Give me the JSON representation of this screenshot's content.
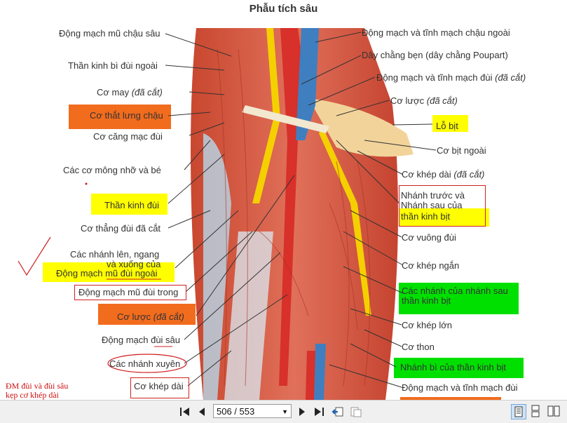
{
  "document": {
    "title": "Phẫu tích sâu",
    "labels_left": [
      "Động mạch mũ chậu sâu",
      "Thần kinh bì đùi ngoài",
      "Cơ may",
      "Cơ thắt lưng chậu",
      "Cơ căng mạc đùi",
      "Các cơ mông nhỡ và bé",
      "Thần kinh đùi",
      "Cơ thẳng đùi đã cắt",
      "Các nhánh lên, ngang",
      "và xuống của",
      "Động mạch mũ đùi ngoài",
      "Động mạch mũ đùi trong",
      "Cơ lược",
      "Động mạch đùi sâu",
      "Các nhánh xuyên",
      "Cơ khép dài"
    ],
    "labels_right": [
      "Động mạch và tĩnh mạch chậu ngoài",
      "Dây chằng bẹn (dây chằng Poupart)",
      "Động mạch và tĩnh mạch đùi",
      "Cơ lược",
      "Lỗ bịt",
      "Cơ bịt ngoài",
      "Cơ khép dài",
      "Nhánh trước và",
      "Nhánh sau của",
      "thần kinh bịt",
      "Cơ vuông đùi",
      "Cơ khép ngắn",
      "Các nhánh của nhánh sau",
      "thần kinh bịt",
      "Cơ khép lớn",
      "Cơ thon",
      "Nhánh bì của thần kinh bịt",
      "Động mạch và tĩnh mạch đùi"
    ],
    "cut_note": "(đã cắt)",
    "handwritten_note": [
      "ĐM đùi và đùi sâu",
      "kẹp cơ khép dài"
    ],
    "colors": {
      "orange": "#f26c1e",
      "yellow": "#ffff00",
      "green": "#00e000",
      "annotation_red": "#d02020"
    }
  },
  "toolbar": {
    "page_display": "506 / 553",
    "icons": [
      "first-page-icon",
      "prev-page-icon",
      "next-page-icon",
      "last-page-icon",
      "go-back-icon",
      "go-forward-icon",
      "single-page-view-icon",
      "continuous-view-icon",
      "two-page-view-icon"
    ]
  }
}
